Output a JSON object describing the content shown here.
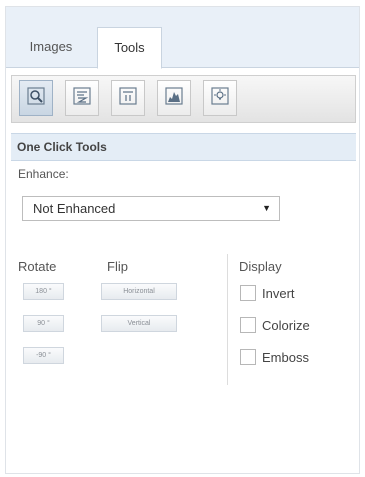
{
  "tabs": [
    {
      "label": "Images",
      "active": false
    },
    {
      "label": "Tools",
      "active": true
    }
  ],
  "toolbar": {
    "buttons": [
      {
        "icon": "zoom-tool-icon",
        "active": true
      },
      {
        "icon": "text-align-icon",
        "active": false
      },
      {
        "icon": "adjust-icon",
        "active": false
      },
      {
        "icon": "histogram-icon",
        "active": false
      },
      {
        "icon": "lightbulb-icon",
        "active": false
      }
    ]
  },
  "section": {
    "title": "One Click Tools"
  },
  "enhance": {
    "label": "Enhance:",
    "selected": "Not Enhanced"
  },
  "rotate": {
    "label": "Rotate",
    "buttons": [
      "180 °",
      "90 °",
      "-90 °"
    ]
  },
  "flip": {
    "label": "Flip",
    "buttons": [
      "Horizontal",
      "Vertical"
    ]
  },
  "display": {
    "label": "Display",
    "options": [
      "Invert",
      "Colorize",
      "Emboss"
    ]
  },
  "colors": {
    "accent": "#e4edf6",
    "border": "#c9d4e0"
  }
}
